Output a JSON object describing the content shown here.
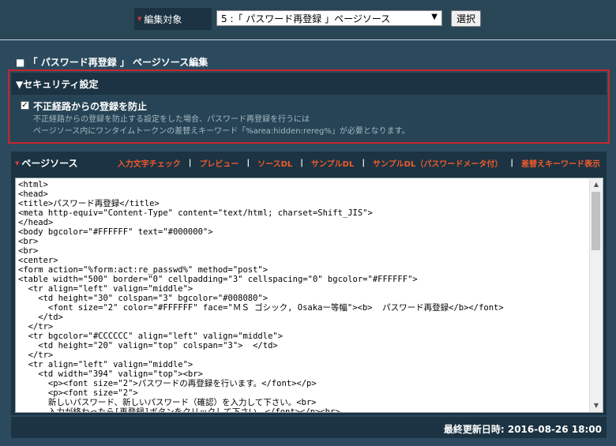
{
  "header": {
    "target_label": "編集対象",
    "target_select_value": "5 :「 パスワード再登録 」ページソース",
    "select_button": "選択"
  },
  "section_title": "■ 「 パスワード再登録 」 ページソース編集",
  "security": {
    "header": "▼セキュリティ設定",
    "checkbox_checked": true,
    "checkbox_label": "不正経路からの登録を防止",
    "desc_line1": "不正経路からの登録を防止する設定をした場合、パスワード再登録を行うには",
    "desc_line2": "ページソース内にワンタイムトークンの差替えキーワード「%area:hidden:rereg%」が必要となります。"
  },
  "editor": {
    "title": "ページソース",
    "links": [
      "入力文字チェック",
      "プレビュー",
      "ソースDL",
      "サンプルDL",
      "サンプルDL（パスワードメータ付）",
      "差替えキーワード表示"
    ],
    "source": "<html>\n<head>\n<title>パスワード再登録</title>\n<meta http-equiv=\"Content-Type\" content=\"text/html; charset=Shift_JIS\">\n</head>\n<body bgcolor=\"#FFFFFF\" text=\"#000000\">\n<br>\n<br>\n<center>\n<form action=\"%form:act:re_passwd%\" method=\"post\">\n<table width=\"500\" border=\"0\" cellpadding=\"3\" cellspacing=\"0\" bgcolor=\"#FFFFFF\">\n  <tr align=\"left\" valign=\"middle\">\n    <td height=\"30\" colspan=\"3\" bgcolor=\"#008080\">\n      <font size=\"2\" color=\"#FFFFFF\" face=\"ＭＳ ゴシック, Osakaー等幅\"><b>  パスワード再登録</b></font>\n    </td>\n  </tr>\n  <tr bgcolor=\"#CCCCCC\" align=\"left\" valign=\"middle\">\n    <td height=\"20\" valign=\"top\" colspan=\"3\">  </td>\n  </tr>\n  <tr align=\"left\" valign=\"middle\">\n    <td width=\"394\" valign=\"top\"><br>\n      <p><font size=\"2\">パスワードの再登録を行います。</font></p>\n      <p><font size=\"2\">\n      新しいパスワード、新しいパスワード（確認）を入力して下さい。<br>\n      入力が終わったら[再登録]ボタンをクリックして下さい。</font></p><br>"
  },
  "footer": {
    "last_updated": "最終更新日時: 2016-08-26 18:00"
  },
  "colors": {
    "background": "#2b4a5e",
    "panel": "#1b3342",
    "link": "#f15a2b",
    "highlight_border": "#c8262a"
  }
}
